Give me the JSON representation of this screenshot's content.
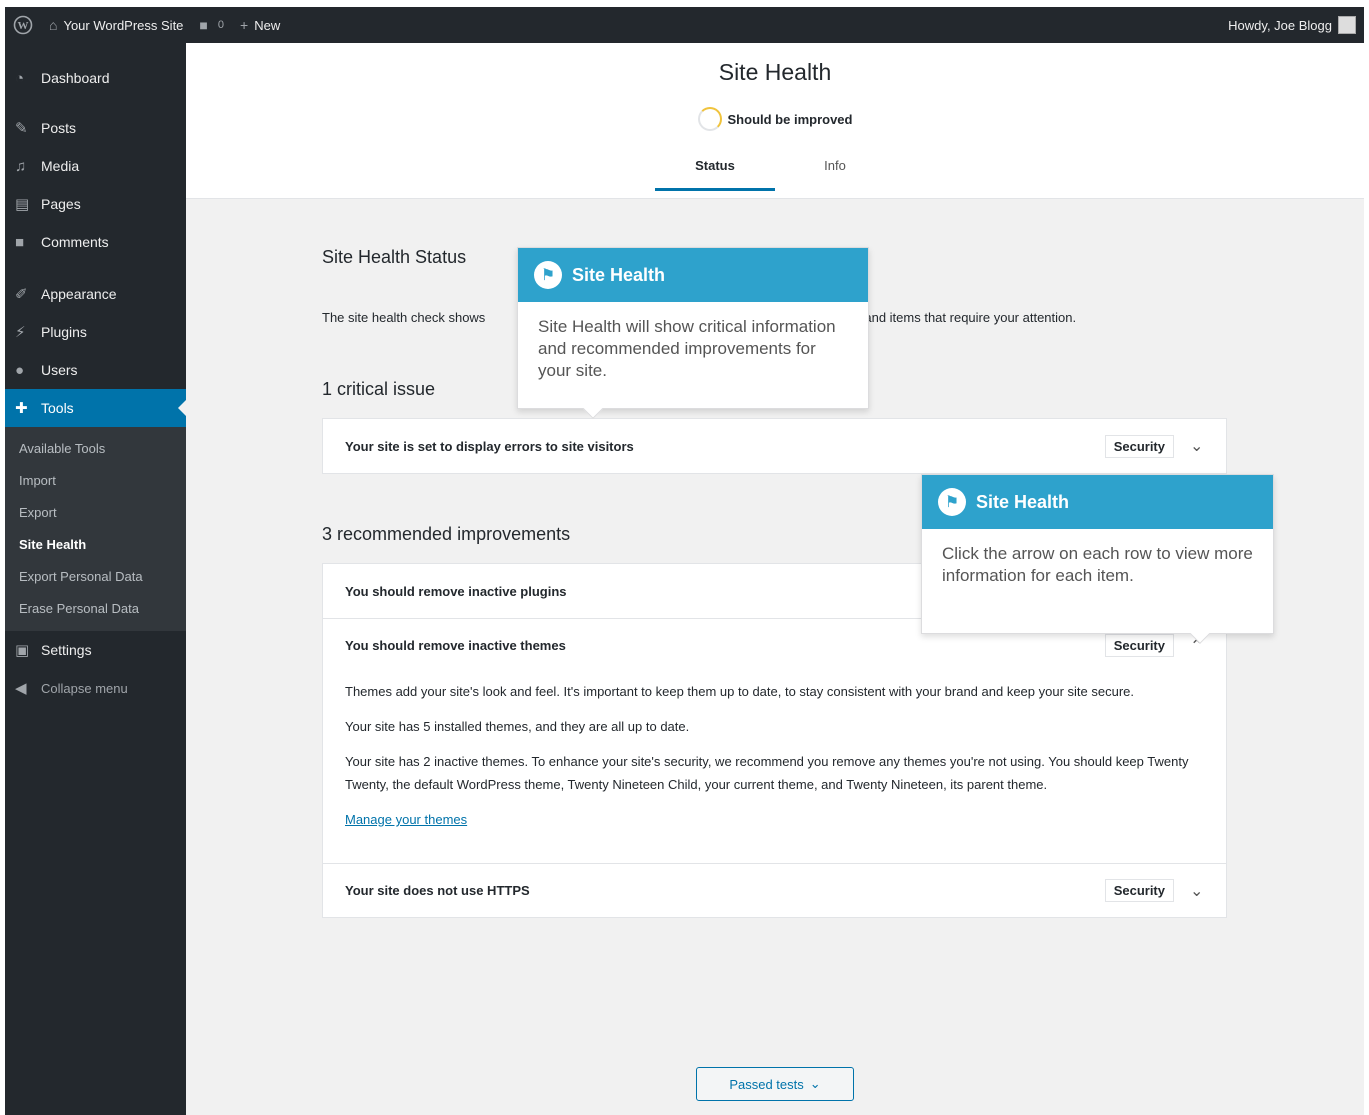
{
  "adminbar": {
    "site_name": "Your WordPress Site",
    "comments_count": "0",
    "new_label": "New",
    "howdy": "Howdy, Joe Blogg"
  },
  "sidebar": {
    "items": [
      {
        "label": "Dashboard",
        "icon": "dashboard-icon"
      },
      {
        "label": "Posts",
        "icon": "pin-icon"
      },
      {
        "label": "Media",
        "icon": "media-icon"
      },
      {
        "label": "Pages",
        "icon": "pages-icon"
      },
      {
        "label": "Comments",
        "icon": "comment-icon"
      },
      {
        "label": "Appearance",
        "icon": "brush-icon"
      },
      {
        "label": "Plugins",
        "icon": "plug-icon"
      },
      {
        "label": "Users",
        "icon": "users-icon"
      },
      {
        "label": "Tools",
        "icon": "wrench-icon"
      }
    ],
    "submenu": [
      "Available Tools",
      "Import",
      "Export",
      "Site Health",
      "Export Personal Data",
      "Erase Personal Data"
    ],
    "settings_label": "Settings",
    "collapse_label": "Collapse menu"
  },
  "header": {
    "title": "Site Health",
    "score_label": "Should be improved",
    "tabs": [
      "Status",
      "Info"
    ]
  },
  "main": {
    "status_heading": "Site Health Status",
    "description_start": "The site health check shows",
    "description_end": "ation and items that require your attention.",
    "critical_heading": "1 critical issue",
    "critical_items": [
      {
        "title": "Your site is set to display errors to site visitors",
        "badge": "Security"
      }
    ],
    "recommended_heading": "3 recommended improvements",
    "recommended_items": [
      {
        "title": "You should remove inactive plugins"
      },
      {
        "title": "You should remove inactive themes",
        "badge": "Security"
      },
      {
        "title": "Your site does not use HTTPS",
        "badge": "Security"
      }
    ],
    "expanded_panel": {
      "p1": "Themes add your site's look and feel. It's important to keep them up to date, to stay consistent with your brand and keep your site secure.",
      "p2": "Your site has 5 installed themes, and they are all up to date.",
      "p3": "Your site has 2 inactive themes. To enhance your site's security, we recommend you remove any themes you're not using. You should keep Twenty Twenty, the default WordPress theme, Twenty Nineteen Child, your current theme, and Twenty Nineteen, its parent theme.",
      "link": "Manage your themes"
    },
    "passed_tests_label": "Passed tests"
  },
  "tooltips": [
    {
      "title": "Site Health",
      "body": "Site Health will show critical information and recommended improvements for your site."
    },
    {
      "title": "Site Health",
      "body": "Click the arrow on each row to view more information for each item."
    }
  ],
  "colors": {
    "adminbar_bg": "#23282d",
    "accent": "#0073aa",
    "pointer_header": "#2ea2cc",
    "score_ring": "#f0c33c"
  }
}
